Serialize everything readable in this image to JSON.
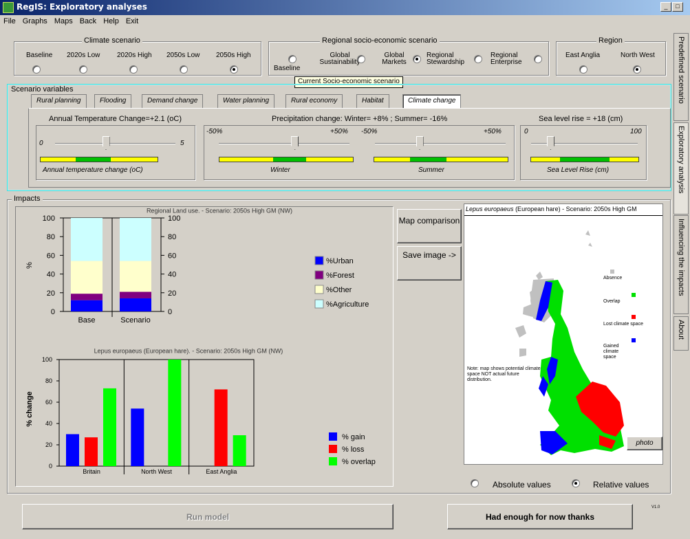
{
  "window": {
    "title": "RegIS: Exploratory analyses"
  },
  "menu": [
    "File",
    "Graphs",
    "Maps",
    "Back",
    "Help",
    "Exit"
  ],
  "climate": {
    "title": "Climate scenario",
    "options": [
      {
        "label": "Baseline",
        "selected": false
      },
      {
        "label": "2020s Low",
        "selected": false
      },
      {
        "label": "2020s High",
        "selected": false
      },
      {
        "label": "2050s Low",
        "selected": false
      },
      {
        "label": "2050s High",
        "selected": true
      }
    ]
  },
  "socio": {
    "title": "Regional socio-economic scenario",
    "options": [
      {
        "label": "Baseline",
        "selected": false
      },
      {
        "label": "Global Sustainability",
        "selected": false
      },
      {
        "label": "Global Markets",
        "selected": true
      },
      {
        "label": "Regional Stewardship",
        "selected": false
      },
      {
        "label": "Regional Enterprise",
        "selected": false
      }
    ],
    "tooltip": "Current Socio-economic scenario"
  },
  "region": {
    "title": "Region",
    "options": [
      {
        "label": "East Anglia",
        "selected": false
      },
      {
        "label": "North West",
        "selected": true
      }
    ]
  },
  "scenario_vars": {
    "title": "Scenario variables",
    "tabs": [
      "Rural planning",
      "Flooding",
      "Demand change",
      "Water planning",
      "Rural economy",
      "Habitat",
      "Climate change"
    ],
    "active_tab": "Climate change",
    "temp": {
      "heading": "Annual Temperature Change=+2.1 (oC)",
      "min": "0",
      "max": "5",
      "value": 2.1,
      "caption": "Annual temperature change (oC)"
    },
    "precip": {
      "heading": "Precipitation change: Winter= +8% ; Summer= -16%",
      "winter": {
        "min": "-50%",
        "max": "+50%",
        "value": 8,
        "caption": "Winter"
      },
      "summer": {
        "min": "-50%",
        "max": "+50%",
        "value": -16,
        "caption": "Summer"
      }
    },
    "sea": {
      "heading": "Sea level rise = +18 (cm)",
      "min": "0",
      "max": "100",
      "value": 18,
      "caption": "Sea Level Rise (cm)"
    }
  },
  "impacts": {
    "title": "Impacts"
  },
  "buttons": {
    "map_comparison": "Map comparison",
    "save_image": "Save image ->",
    "run_model": "Run model",
    "enough": "Had enough for now thanks",
    "photo": "photo"
  },
  "version": "V1.0",
  "colors": {
    "urban": "#0000ff",
    "forest": "#800080",
    "other": "#ffffcc",
    "agriculture": "#ccffff",
    "gain": "#0000ff",
    "loss": "#ff0000",
    "overlap": "#00ff00",
    "absence": "#c0c0c0"
  },
  "map": {
    "title_species": "Lepus europaeus",
    "title_rest": " (European hare) - Scenario: 2050s High GM",
    "legend": [
      "Absence",
      "Overlap",
      "Lost climate space",
      "Gained climate space"
    ],
    "note": "Note: map shows potential climate space NOT actual future distribution.",
    "radio": [
      {
        "label": "Absolute values",
        "selected": false
      },
      {
        "label": "Relative values",
        "selected": true
      }
    ]
  },
  "side_tabs": [
    "Predefined scenario",
    "Exploratory analysis",
    "Influencing the impacts",
    "About"
  ],
  "chart_data": [
    {
      "type": "bar",
      "title": "Regional Land use. - Scenario: 2050s High GM (NW)",
      "categories": [
        "Base",
        "Scenario"
      ],
      "ylabel": "%",
      "ylim": [
        0,
        100
      ],
      "yticks": [
        0,
        20,
        40,
        60,
        80,
        100
      ],
      "stacked": true,
      "series": [
        {
          "name": "%Urban",
          "values": [
            12,
            14
          ]
        },
        {
          "name": "%Forest",
          "values": [
            7,
            7
          ]
        },
        {
          "name": "%Other",
          "values": [
            35,
            33
          ]
        },
        {
          "name": "%Agriculture",
          "values": [
            46,
            46
          ]
        }
      ]
    },
    {
      "type": "bar",
      "title": "Lepus europaeus (European hare). - Scenario: 2050s High GM (NW)",
      "categories": [
        "Britain",
        "North West",
        "East Anglia"
      ],
      "ylabel": "% change",
      "ylim": [
        0,
        100
      ],
      "yticks": [
        0,
        20,
        40,
        60,
        80,
        100
      ],
      "series": [
        {
          "name": "% gain",
          "values": [
            30,
            54,
            0
          ]
        },
        {
          "name": "% loss",
          "values": [
            27,
            0,
            72
          ]
        },
        {
          "name": "% overlap",
          "values": [
            73,
            100,
            29
          ]
        }
      ]
    }
  ]
}
